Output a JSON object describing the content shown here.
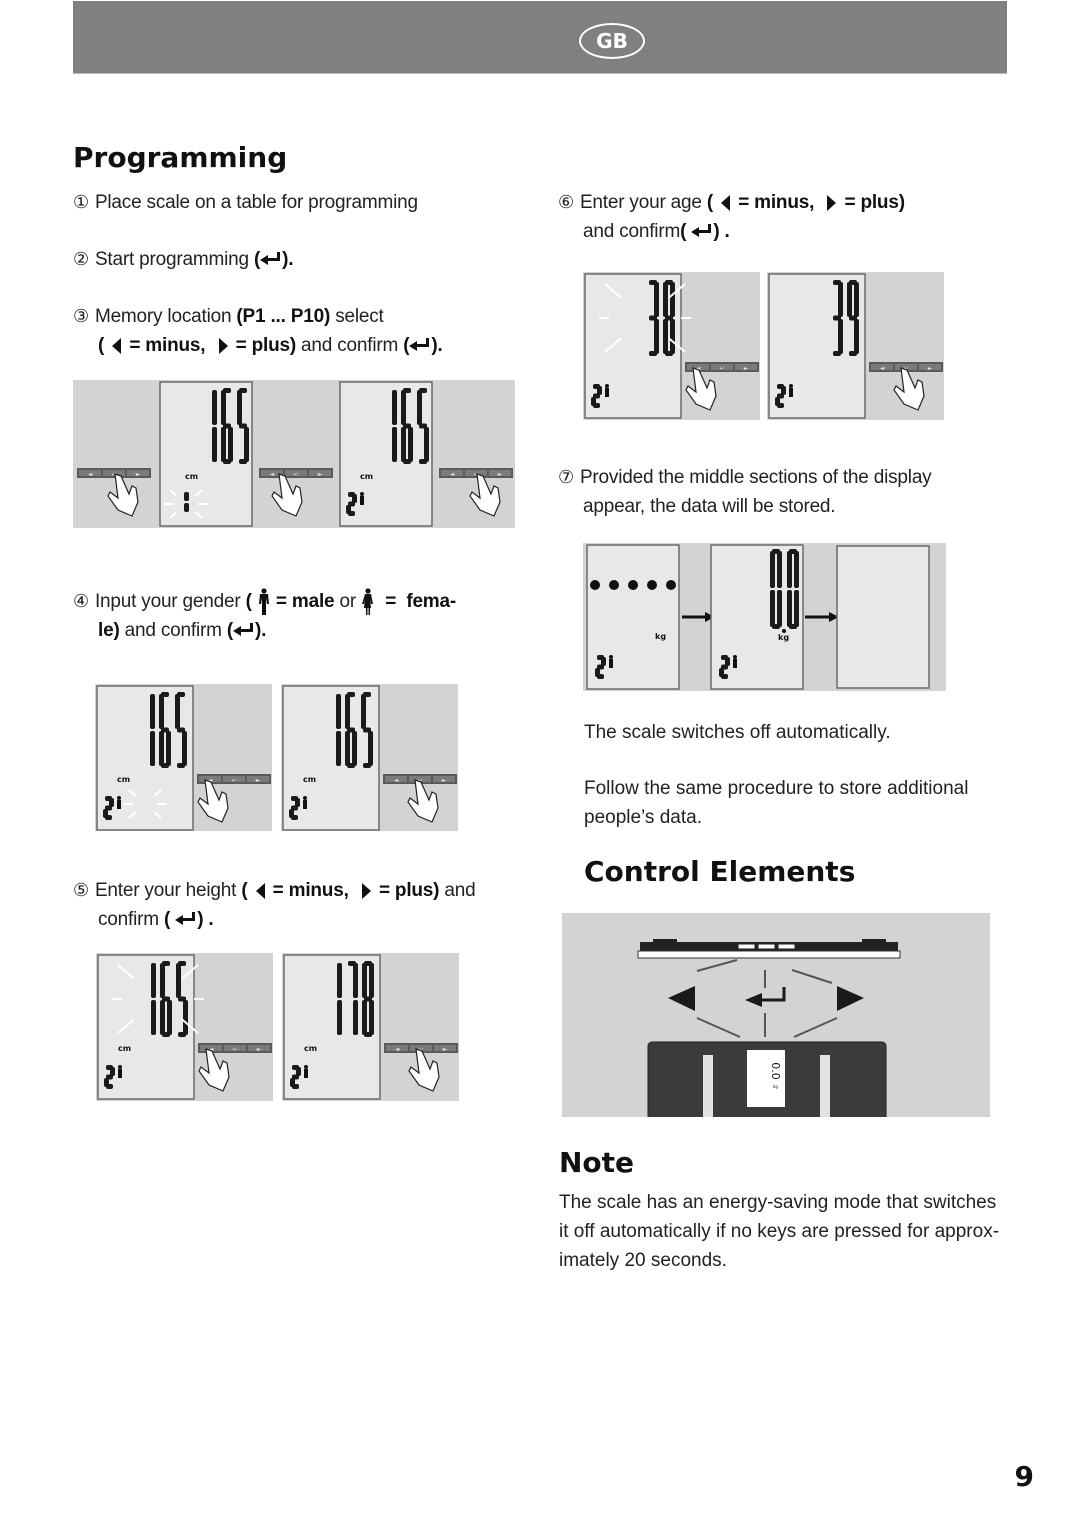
{
  "header": {
    "badge": "GB"
  },
  "programming": {
    "title": "Programming",
    "steps": [
      {
        "num": "①",
        "text": "Place scale on a table for programming"
      },
      {
        "num": "②",
        "text": "Start programming",
        "enter": "(",
        "enter_close": ")."
      },
      {
        "num": "③",
        "pre": "Memory location ",
        "bold": "(P1 ... P10)",
        "post": " select",
        "line2_open": "(",
        "minus": "= minus,",
        "plus": "= plus)",
        "and_confirm": " and confirm ",
        "close": ")."
      },
      {
        "num": "④",
        "pre": "Input your gender ",
        "open": "(",
        "male_eq": "=",
        "male": "male",
        "or": " or ",
        "female_eq": "=",
        "female_1": "fema-",
        "female_2": "le)",
        "and_confirm": " and confirm ",
        "close": ")."
      },
      {
        "num": "⑤",
        "pre": "Enter your height ",
        "open": "(",
        "minus": "= minus,",
        "plus": "= plus)",
        "and": " and",
        "confirm": "confirm ",
        "close": ") ."
      },
      {
        "num": "⑥",
        "pre": "Enter your age ",
        "open": "(",
        "minus": "= minus,",
        "plus": "= plus)",
        "confirm": "and confirm",
        "close": ") ."
      },
      {
        "num": "⑦",
        "line1": "Provided the middle sections of the display",
        "line2": "appear, the data will be stored."
      }
    ],
    "auto_off": "The scale switches off automatically.",
    "follow_1": "Follow the same procedure to store additional",
    "follow_2": "people’s data."
  },
  "figures": {
    "step3": [
      {
        "value": "165",
        "unit": "cm",
        "memory": "1",
        "blink_memory": true
      },
      {
        "value": "165",
        "unit": "cm",
        "memory": "2",
        "blink_memory": false
      }
    ],
    "step4": [
      {
        "value": "165",
        "unit": "cm",
        "memory": "2",
        "blink_gender": true,
        "finger": "left"
      },
      {
        "value": "165",
        "unit": "cm",
        "memory": "2",
        "blink_gender": false,
        "finger": "enter"
      }
    ],
    "step5": [
      {
        "value": "165",
        "unit": "cm",
        "memory": "2",
        "blink_value": true,
        "finger": "left"
      },
      {
        "value": "178",
        "unit": "cm",
        "memory": "2",
        "blink_value": false,
        "finger": "enter"
      }
    ],
    "step6": [
      {
        "value": "38",
        "memory": "2",
        "blink_value": true,
        "finger": "left"
      },
      {
        "value": "39",
        "memory": "2",
        "blink_value": false,
        "finger": "enter"
      }
    ],
    "step7": [
      {
        "dots": 5,
        "unit": "kg",
        "memory": "2"
      },
      {
        "value": "0.0",
        "unit": "kg",
        "memory": "2"
      },
      {
        "blank": true
      }
    ],
    "buttons": [
      "◄",
      "↵",
      "►"
    ]
  },
  "control_elements": {
    "title": "Control Elements",
    "display_value": "0.0",
    "display_unit": "kg"
  },
  "note": {
    "title": "Note",
    "lines": [
      "The scale has an energy-saving mode that switches",
      "it off automatically if no keys are pressed for approx-",
      "imately 20 seconds."
    ]
  },
  "page_number": "9"
}
